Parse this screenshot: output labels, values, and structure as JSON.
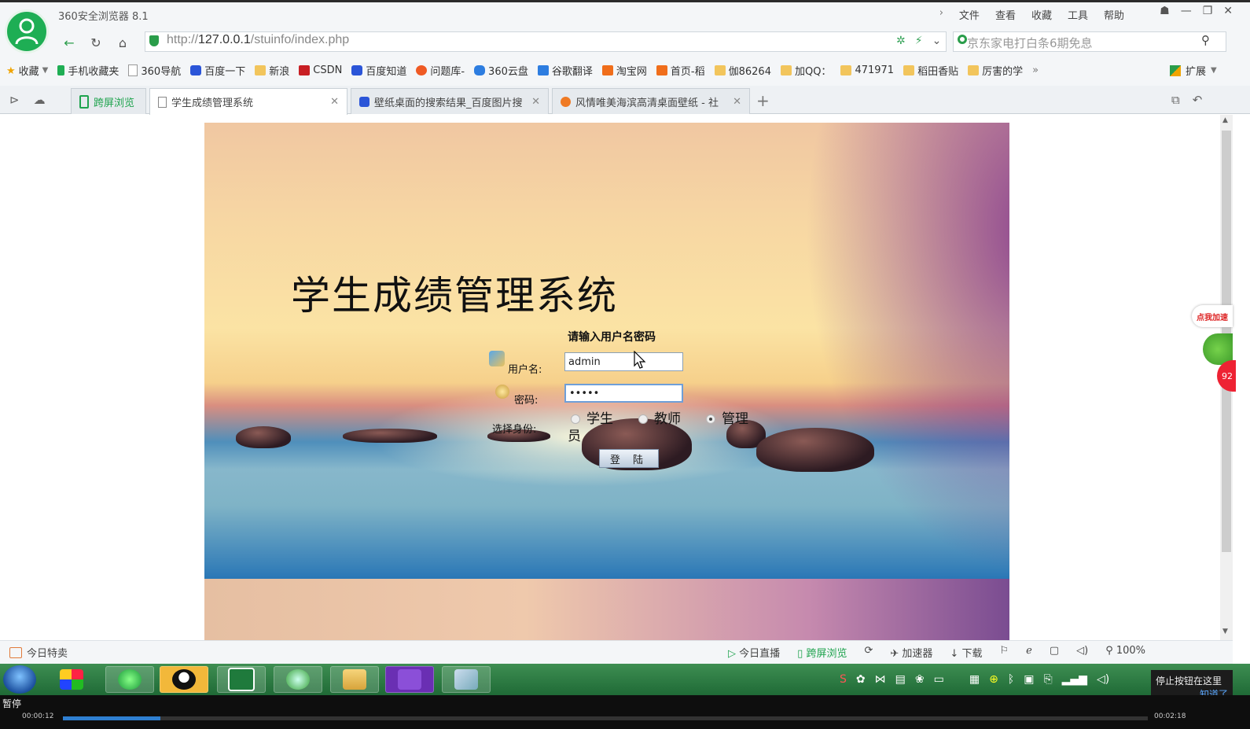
{
  "browser": {
    "title": "360安全浏览器 8.1",
    "menu": [
      "文件",
      "查看",
      "收藏",
      "工具",
      "帮助"
    ],
    "url_prefix": "http://",
    "url_host": "127.0.0.1",
    "url_path": "/stuinfo/index.php",
    "search_placeholder": "京东家电打白条6期免息"
  },
  "bookmarks": [
    {
      "label": "收藏",
      "icon": "star-icon"
    },
    {
      "label": "手机收藏夹",
      "icon": "phone-icon"
    },
    {
      "label": "360导航",
      "icon": "page-icon"
    },
    {
      "label": "百度一下",
      "icon": "baidu-paw-icon"
    },
    {
      "label": "新浪",
      "icon": "folder-icon"
    },
    {
      "label": "CSDN",
      "icon": "csdn-icon"
    },
    {
      "label": "百度知道",
      "icon": "baidu-paw-icon"
    },
    {
      "label": "问题库-",
      "icon": "sogou-icon"
    },
    {
      "label": "360云盘",
      "icon": "cloud-icon"
    },
    {
      "label": "谷歌翻译",
      "icon": "translate-icon"
    },
    {
      "label": "淘宝网",
      "icon": "taobao-icon"
    },
    {
      "label": "首页-稻",
      "icon": "taobao-icon"
    },
    {
      "label": "伽86264",
      "icon": "folder-icon"
    },
    {
      "label": "加QQ：",
      "icon": "folder-icon"
    },
    {
      "label": "471971",
      "icon": "folder-icon"
    },
    {
      "label": "稻田香贴",
      "icon": "folder-icon"
    },
    {
      "label": "厉害的学",
      "icon": "folder-icon"
    }
  ],
  "bookmarks_more": "»",
  "extensions_label": "扩展",
  "tabs": [
    {
      "label": "跨屏浏览"
    },
    {
      "label": "学生成绩管理系统",
      "active": true
    },
    {
      "label": "壁纸桌面的搜索结果_百度图片搜"
    },
    {
      "label": "风情唯美海滨高清桌面壁纸 - 社"
    }
  ],
  "login": {
    "system_title": "学生成绩管理系统",
    "prompt": "请输入用户名密码",
    "username_label": "用户名:",
    "username_value": "admin",
    "password_label": "密码:",
    "password_value": "•••••",
    "role_label": "选择身份:",
    "roles": [
      "学生",
      "教师",
      "管理员"
    ],
    "selected_role": "管理员",
    "login_button": "登 陆"
  },
  "side_widget": {
    "label": "点我加速",
    "count": "92"
  },
  "statusbar": {
    "left": "今日特卖",
    "live": "今日直播",
    "crossscreen": "跨屏浏览",
    "accelerator": "加速器",
    "download": "下载",
    "zoom": "100%"
  },
  "notification": {
    "text": "停止按钮在这里",
    "link": "知道了"
  },
  "video": {
    "state": "暂停",
    "current": "00:00:12",
    "total": "00:02:18",
    "progress": 0.09
  }
}
